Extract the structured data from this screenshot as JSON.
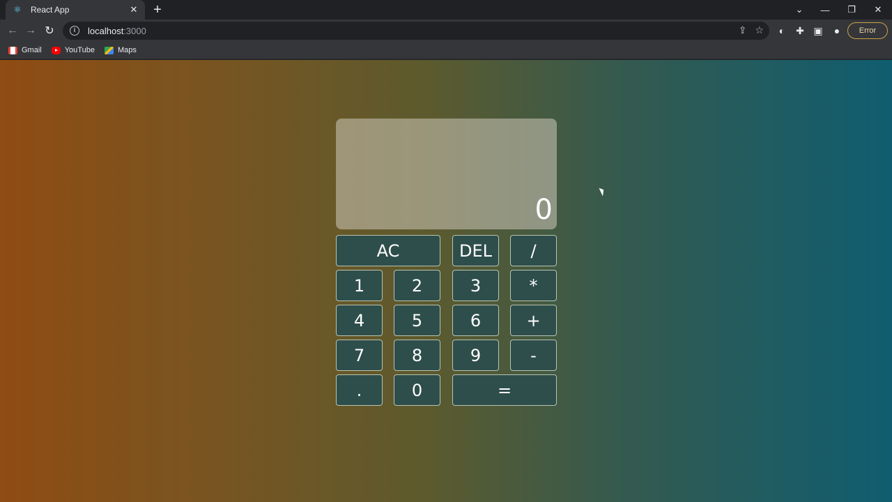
{
  "browser": {
    "tab": {
      "title": "React App",
      "favicon": "react-icon"
    },
    "url": {
      "host": "localhost",
      "port": ":3000"
    },
    "profile_status": "Error",
    "bookmarks": [
      {
        "label": "Gmail",
        "icon": "gmail-icon"
      },
      {
        "label": "YouTube",
        "icon": "youtube-icon"
      },
      {
        "label": "Maps",
        "icon": "maps-icon"
      }
    ]
  },
  "calculator": {
    "display": "0",
    "keys": {
      "ac": "AC",
      "del": "DEL",
      "divide": "/",
      "one": "1",
      "two": "2",
      "three": "3",
      "multiply": "*",
      "four": "4",
      "five": "5",
      "six": "6",
      "plus": "+",
      "seven": "7",
      "eight": "8",
      "nine": "9",
      "minus": "-",
      "dot": ".",
      "zero": "0",
      "equals": "="
    }
  },
  "colors": {
    "gradient_start": "#8f4c13",
    "gradient_end": "#0f5d70",
    "key_background": "#2e4e4b",
    "display_background": "rgba(205,200,185,0.55)"
  }
}
